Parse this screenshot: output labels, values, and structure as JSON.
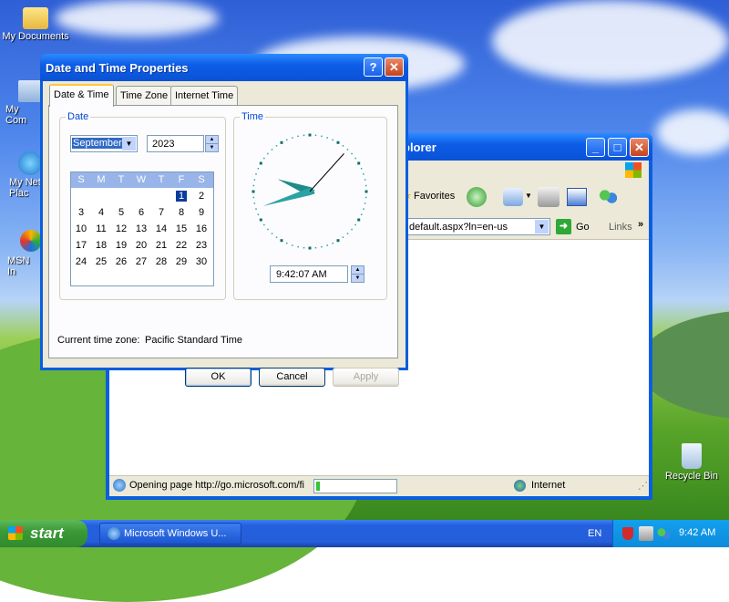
{
  "desktop": {
    "icons": [
      {
        "label": "My Documents",
        "icon": "folder-icon"
      },
      {
        "label": "My Com",
        "icon": "computer-icon"
      },
      {
        "label": "My Net Plac",
        "icon": "network-icon"
      },
      {
        "label": "MSN In",
        "icon": "msn-icon"
      },
      {
        "label": "Recycle Bin",
        "icon": "recycle-bin-icon"
      }
    ]
  },
  "ie_window": {
    "title_visible": "plorer",
    "toolbar": {
      "favorites": "Favorites"
    },
    "address": {
      "value": "default.aspx?ln=en-us",
      "go": "Go",
      "links": "Links"
    },
    "status": {
      "text": "Opening page http://go.microsoft.com/fi",
      "progress": 0.05,
      "zone": "Internet"
    }
  },
  "dialog": {
    "title": "Date and Time Properties",
    "tabs": [
      "Date & Time",
      "Time Zone",
      "Internet Time"
    ],
    "date_group": "Date",
    "month": "September",
    "year": "2023",
    "weekdays": [
      "S",
      "M",
      "T",
      "W",
      "T",
      "F",
      "S"
    ],
    "days": [
      "1",
      "2",
      "3",
      "4",
      "5",
      "6",
      "7",
      "8",
      "9",
      "10",
      "11",
      "12",
      "13",
      "14",
      "15",
      "16",
      "17",
      "18",
      "19",
      "20",
      "21",
      "22",
      "23",
      "24",
      "25",
      "26",
      "27",
      "28",
      "29",
      "30"
    ],
    "selected_day": "1",
    "time_group": "Time",
    "time": "9:42:07 AM",
    "clock": {
      "hour": 9,
      "minute": 42,
      "second": 7
    },
    "timezone_label": "Current time zone:",
    "timezone_value": "Pacific Standard Time",
    "buttons": {
      "ok": "OK",
      "cancel": "Cancel",
      "apply": "Apply"
    }
  },
  "taskbar": {
    "start": "start",
    "task": "Microsoft Windows U...",
    "lang": "EN",
    "clock": "9:42 AM"
  }
}
